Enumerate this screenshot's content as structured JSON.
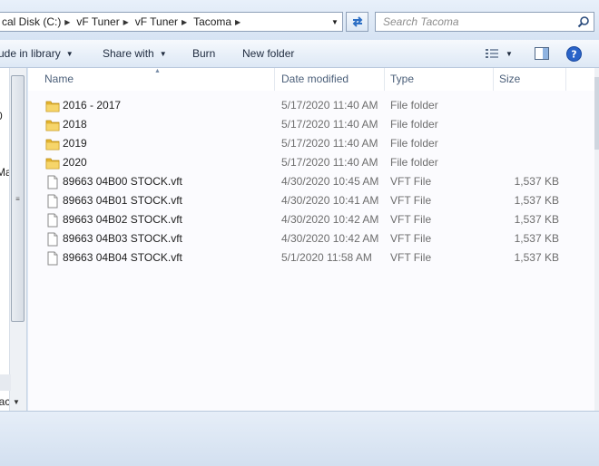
{
  "address": {
    "crumbs": [
      "cal Disk (C:)",
      "vF Tuner",
      "vF Tuner",
      "Tacoma"
    ]
  },
  "search": {
    "placeholder": "Search Tacoma"
  },
  "toolbar": {
    "include_library": "ude in library",
    "share_with": "Share with",
    "burn": "Burn",
    "new_folder": "New folder"
  },
  "nav": {
    "fragments": [
      "0",
      "Ma",
      "lac"
    ]
  },
  "columns": {
    "name": "Name",
    "date_modified": "Date modified",
    "type": "Type",
    "size": "Size"
  },
  "files": [
    {
      "name": "2016 - 2017",
      "date": "5/17/2020 11:40 AM",
      "type": "File folder",
      "size": "",
      "icon": "folder-icon"
    },
    {
      "name": "2018",
      "date": "5/17/2020 11:40 AM",
      "type": "File folder",
      "size": "",
      "icon": "folder-icon"
    },
    {
      "name": "2019",
      "date": "5/17/2020 11:40 AM",
      "type": "File folder",
      "size": "",
      "icon": "folder-icon"
    },
    {
      "name": "2020",
      "date": "5/17/2020 11:40 AM",
      "type": "File folder",
      "size": "",
      "icon": "folder-icon"
    },
    {
      "name": "89663 04B00 STOCK.vft",
      "date": "4/30/2020 10:45 AM",
      "type": "VFT File",
      "size": "1,537 KB",
      "icon": "file-icon"
    },
    {
      "name": "89663 04B01 STOCK.vft",
      "date": "4/30/2020 10:41 AM",
      "type": "VFT File",
      "size": "1,537 KB",
      "icon": "file-icon"
    },
    {
      "name": "89663 04B02 STOCK.vft",
      "date": "4/30/2020 10:42 AM",
      "type": "VFT File",
      "size": "1,537 KB",
      "icon": "file-icon"
    },
    {
      "name": "89663 04B03 STOCK.vft",
      "date": "4/30/2020 10:42 AM",
      "type": "VFT File",
      "size": "1,537 KB",
      "icon": "file-icon"
    },
    {
      "name": "89663 04B04 STOCK.vft",
      "date": "5/1/2020 11:58 AM",
      "type": "VFT File",
      "size": "1,537 KB",
      "icon": "file-icon"
    }
  ],
  "colors": {
    "folder": "#e8b730",
    "help": "#2a63c8",
    "accent": "#1e2a3e"
  }
}
